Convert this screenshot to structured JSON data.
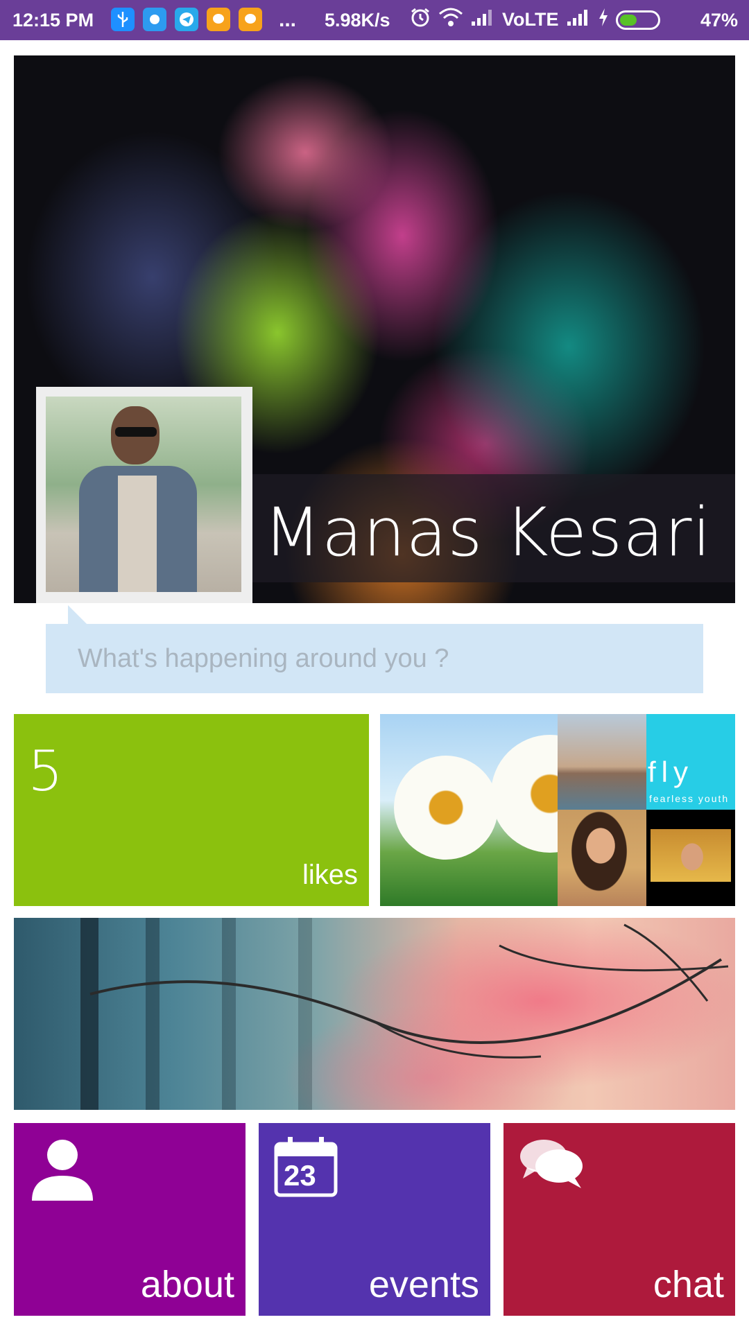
{
  "status_bar": {
    "time": "12:15 PM",
    "more": "...",
    "speed": "5.98K/s",
    "network": "VoLTE",
    "battery_percent": "47%",
    "battery_level": 0.47,
    "app_icons": [
      "usb-icon",
      "app-icon",
      "telegram-icon",
      "chat-bubble-icon",
      "chat-bubble-icon"
    ],
    "colors": {
      "background": "#6a3e98",
      "battery_fill": "#58c227"
    }
  },
  "profile": {
    "name": "Manas Kesari"
  },
  "status_input": {
    "placeholder": "What's happening around you ?"
  },
  "likes": {
    "count": "5",
    "label": "likes",
    "color": "#8bc10e"
  },
  "gallery": {
    "fly_text": "fly",
    "fly_subtext": "fearless youth"
  },
  "nav_tiles": [
    {
      "label": "about",
      "icon": "person-icon",
      "color": "#8f0195"
    },
    {
      "label": "events",
      "icon": "calendar-icon",
      "calendar_day": "23",
      "color": "#5433ae"
    },
    {
      "label": "chat",
      "icon": "chat-bubbles-icon",
      "color": "#ae1a3c"
    }
  ]
}
